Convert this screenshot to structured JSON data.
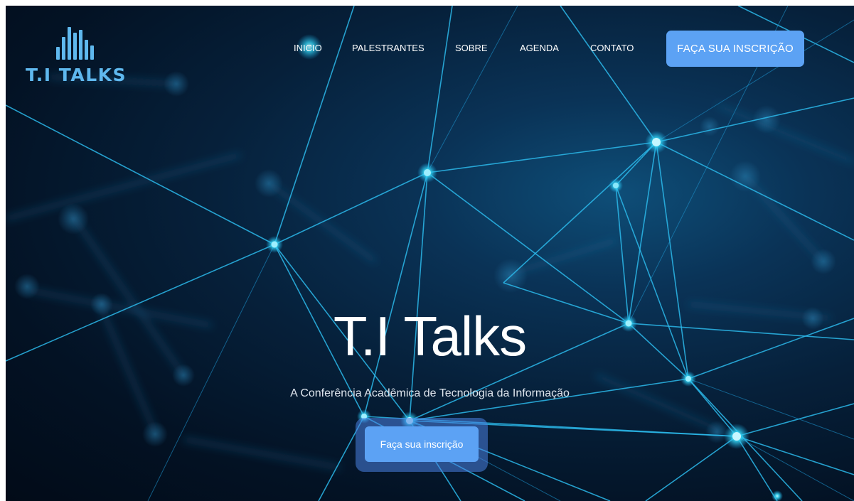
{
  "brand": {
    "logo_text": "T.I TALKS",
    "accent_color": "#5fb8ee"
  },
  "nav": {
    "items": [
      {
        "label": "INICIO"
      },
      {
        "label": "PALESTRANTES"
      },
      {
        "label": "SOBRE"
      },
      {
        "label": "AGENDA"
      },
      {
        "label": "CONTATO"
      }
    ],
    "cta_label": "FAÇA SUA INSCRIÇÃO",
    "cta_color": "#5ca2f4"
  },
  "hero": {
    "title": "T.I Talks",
    "subtitle": "A Conferência Acadêmica de Tecnologia da Informação",
    "cta_label": "Faça sua inscrição",
    "background_icon": "network-mesh-background"
  }
}
